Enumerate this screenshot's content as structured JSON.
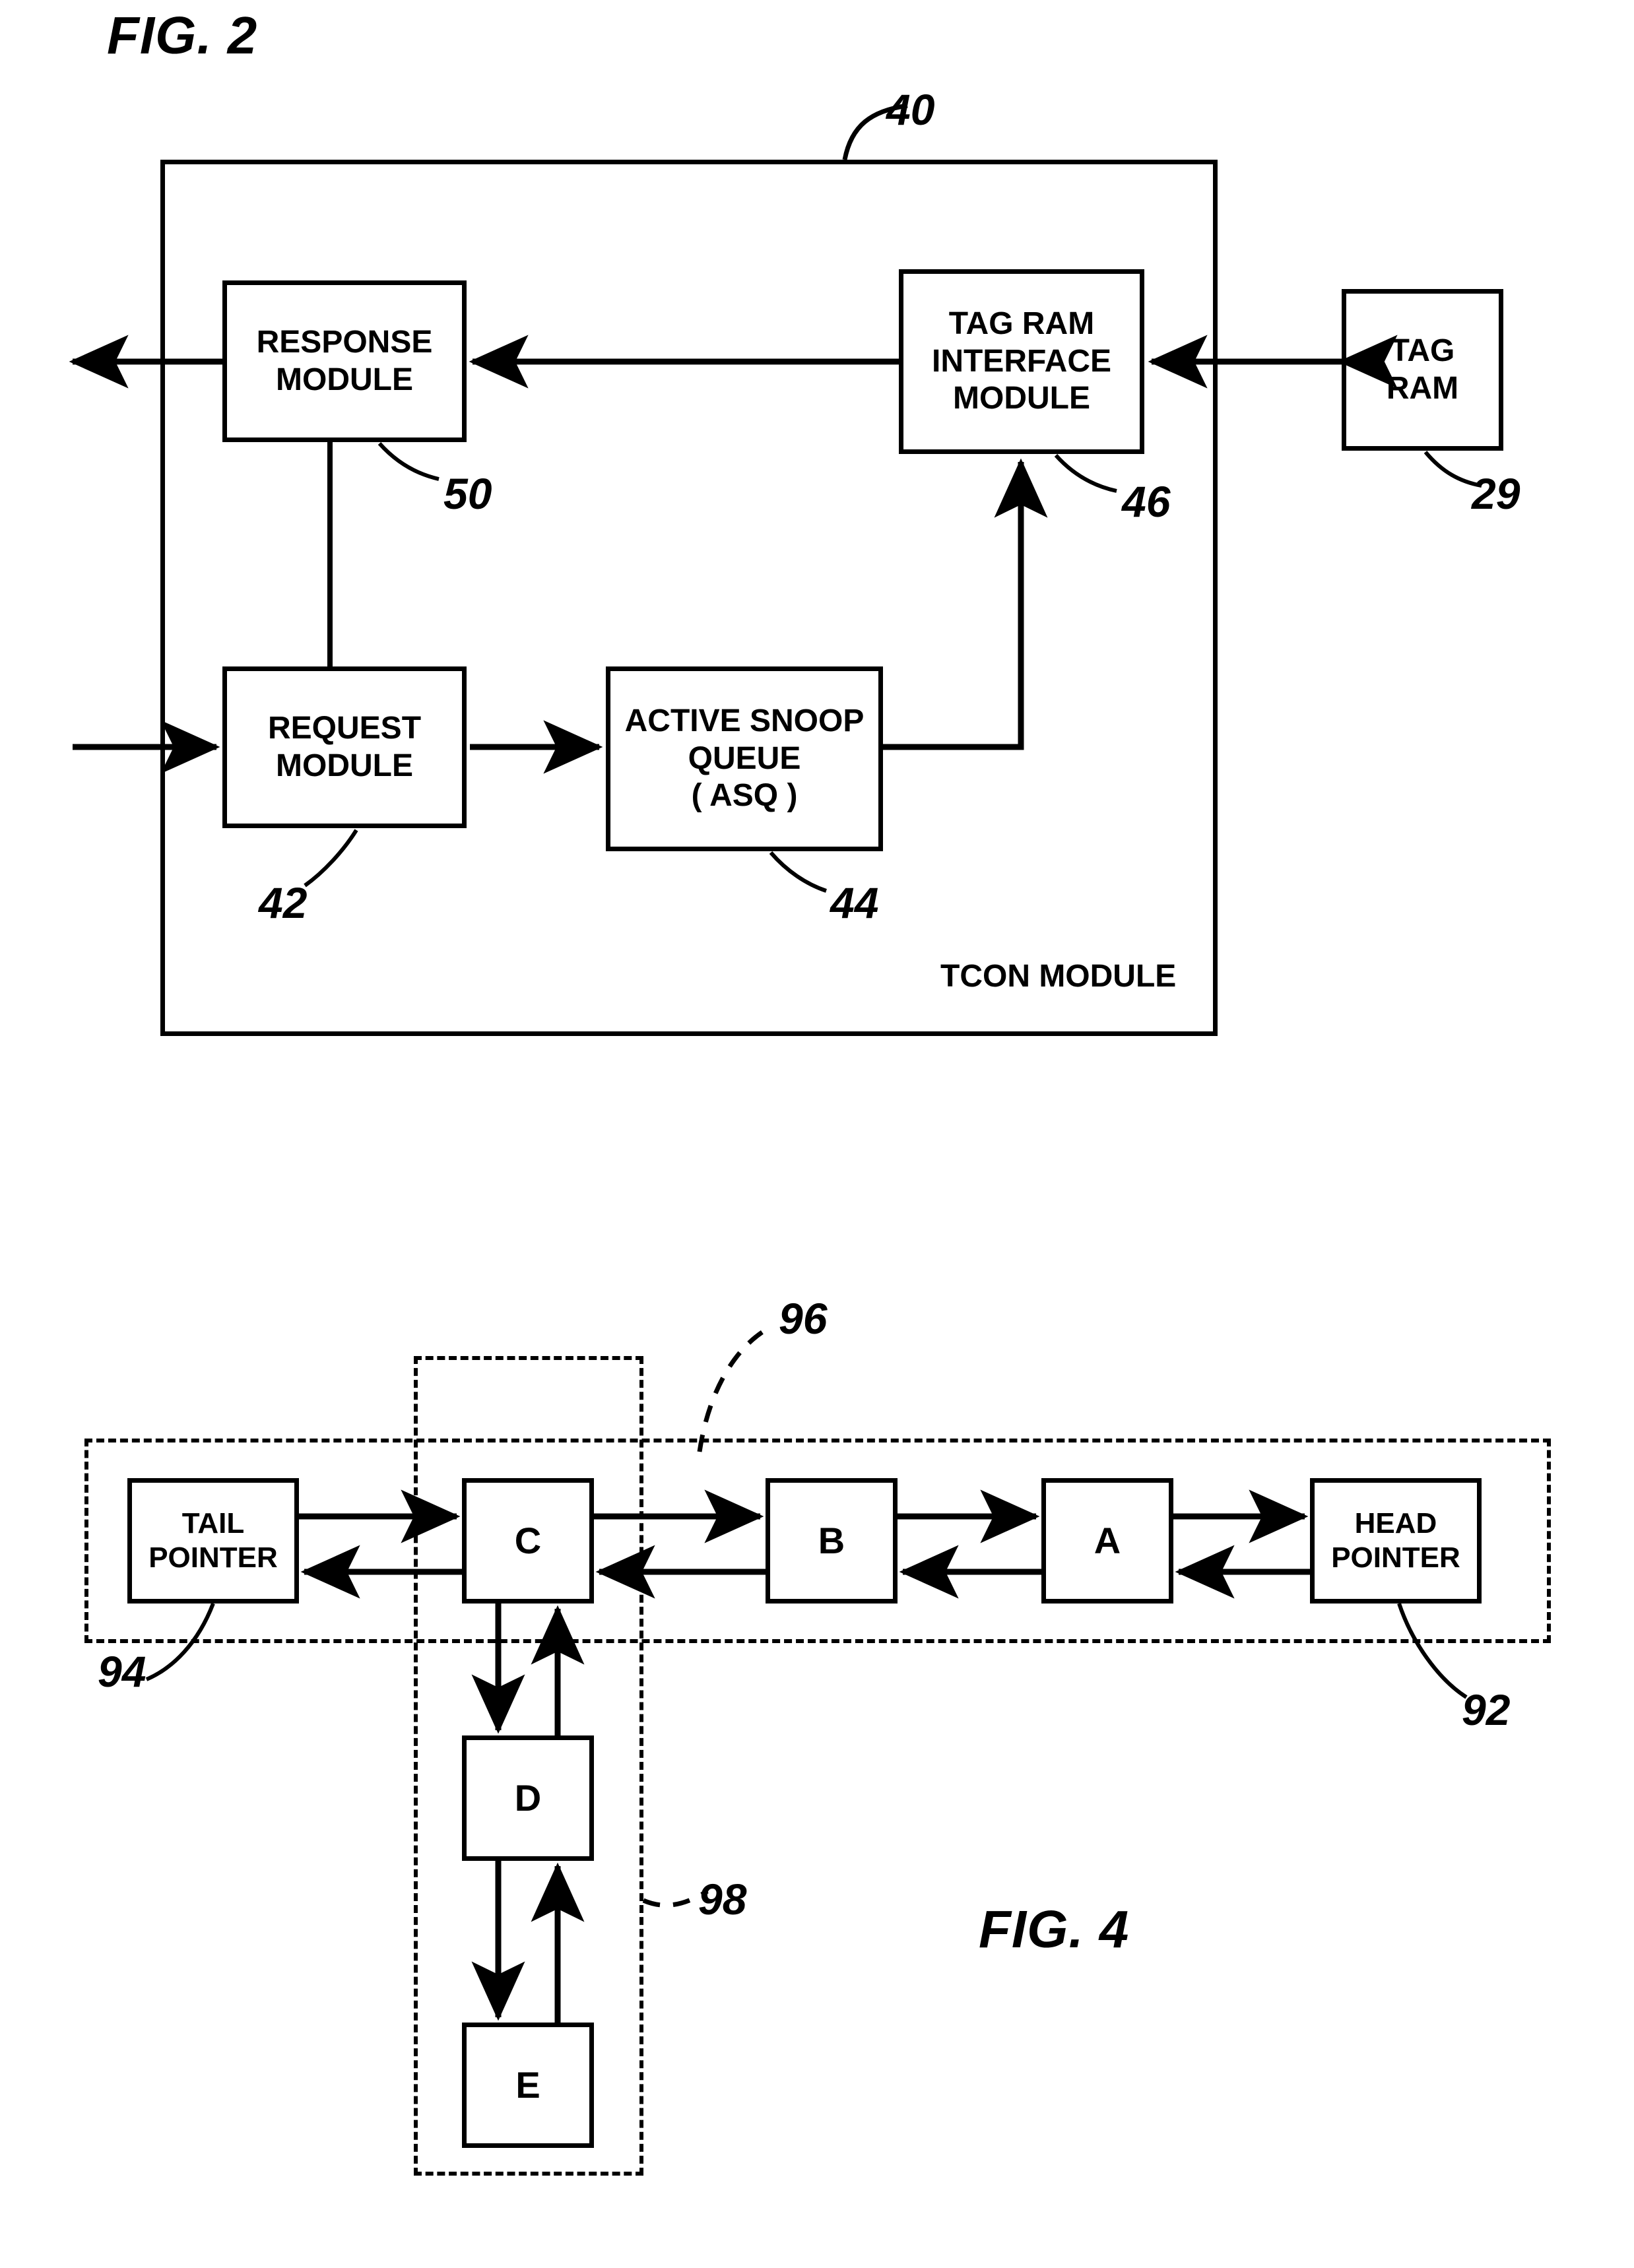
{
  "figures": [
    {
      "id": "fig2",
      "title": "FIG. 2",
      "container_label": "TCON MODULE",
      "container_ref": "40",
      "boxes": [
        {
          "key": "response",
          "lines": [
            "RESPONSE",
            "MODULE"
          ],
          "ref": "50"
        },
        {
          "key": "tagram_if",
          "lines": [
            "TAG RAM",
            "INTERFACE",
            "MODULE"
          ],
          "ref": "46"
        },
        {
          "key": "tagram",
          "lines": [
            "TAG",
            "RAM"
          ],
          "ref": "29"
        },
        {
          "key": "request",
          "lines": [
            "REQUEST",
            "MODULE"
          ],
          "ref": "42"
        },
        {
          "key": "asq",
          "lines": [
            "ACTIVE SNOOP",
            "QUEUE",
            "( ASQ )"
          ],
          "ref": "44"
        }
      ]
    },
    {
      "id": "fig4",
      "title": "FIG. 4",
      "boxes": [
        {
          "key": "tail",
          "lines": [
            "TAIL",
            "POINTER"
          ],
          "ref": "94"
        },
        {
          "key": "c",
          "lines": [
            "C"
          ],
          "ref": ""
        },
        {
          "key": "b",
          "lines": [
            "B"
          ],
          "ref": ""
        },
        {
          "key": "a",
          "lines": [
            "A"
          ],
          "ref": ""
        },
        {
          "key": "head",
          "lines": [
            "HEAD",
            "POINTER"
          ],
          "ref": "92"
        },
        {
          "key": "d",
          "lines": [
            "D"
          ],
          "ref": ""
        },
        {
          "key": "e",
          "lines": [
            "E"
          ],
          "ref": ""
        }
      ],
      "dashed_regions": [
        {
          "key": "horizontal-list",
          "ref": "92"
        },
        {
          "key": "subset",
          "ref": "96"
        },
        {
          "key": "vertical-chain",
          "ref": "98"
        }
      ],
      "refs": [
        "96",
        "94",
        "92",
        "98"
      ]
    }
  ],
  "fig2": {
    "title": "FIG. 2",
    "ref_40": "40",
    "tcon_label": "TCON MODULE",
    "response": {
      "l1": "RESPONSE",
      "l2": "MODULE",
      "ref": "50"
    },
    "tagram_if": {
      "l1": "TAG RAM",
      "l2": "INTERFACE",
      "l3": "MODULE",
      "ref": "46"
    },
    "tagram": {
      "l1": "TAG",
      "l2": "RAM",
      "ref": "29"
    },
    "request": {
      "l1": "REQUEST",
      "l2": "MODULE",
      "ref": "42"
    },
    "asq": {
      "l1": "ACTIVE SNOOP",
      "l2": "QUEUE",
      "l3": "( ASQ )",
      "ref": "44"
    }
  },
  "fig4": {
    "title": "FIG. 4",
    "tail": {
      "l1": "TAIL",
      "l2": "POINTER",
      "ref": "94"
    },
    "head": {
      "l1": "HEAD",
      "l2": "POINTER",
      "ref": "92"
    },
    "node_c": "C",
    "node_b": "B",
    "node_a": "A",
    "node_d": "D",
    "node_e": "E",
    "ref_96": "96",
    "ref_98": "98"
  },
  "colors": {
    "ink": "#000000",
    "paper": "#ffffff"
  }
}
